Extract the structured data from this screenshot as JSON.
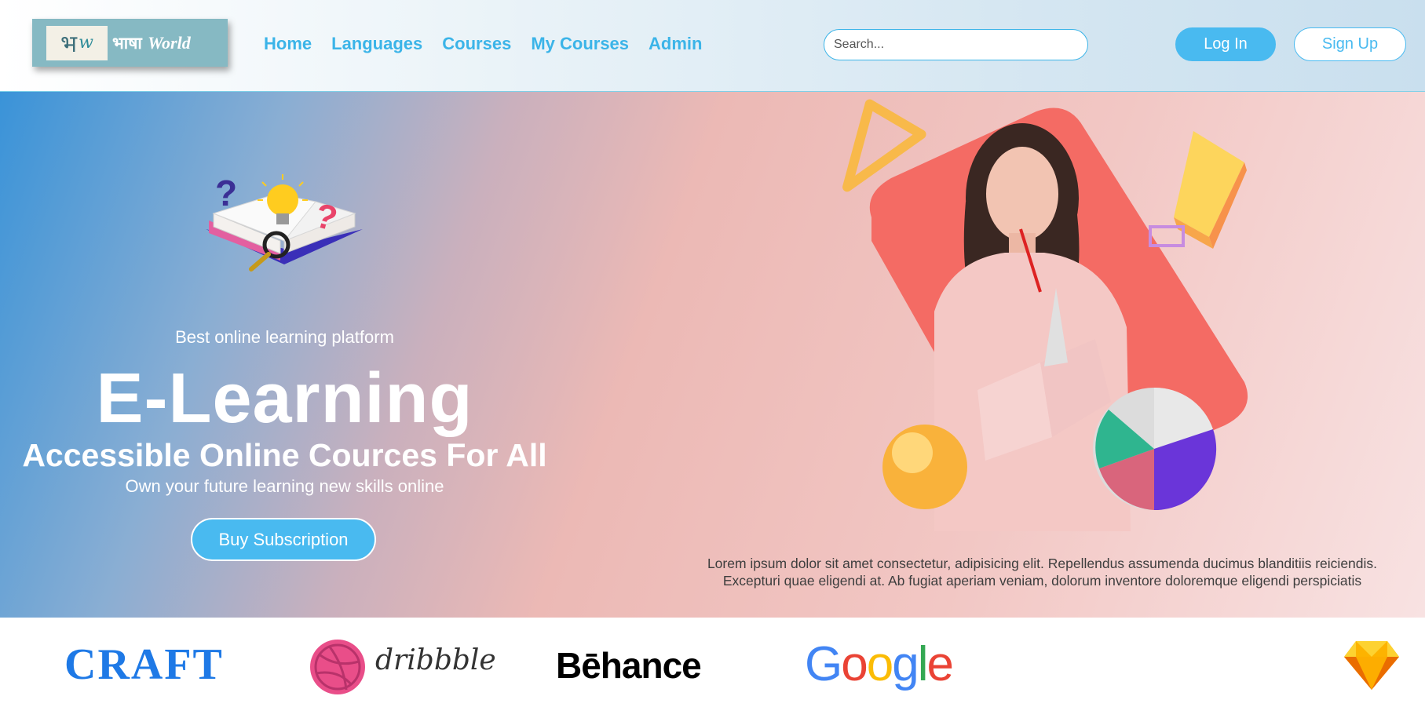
{
  "header": {
    "logo": {
      "mark": "भ",
      "mark_suffix": "w",
      "hindi": "भाषा",
      "english": "World"
    },
    "nav": [
      "Home",
      "Languages",
      "Courses",
      "My Courses",
      "Admin"
    ],
    "search_placeholder": "Search...",
    "login_label": "Log In",
    "signup_label": "Sign Up"
  },
  "hero": {
    "tagline": "Best online learning platform",
    "title": "E-Learning",
    "subtitle": "Accessible Online Cources For All",
    "subtitle2": "Own your future learning new skills online",
    "cta_label": "Buy Subscription",
    "description": "Lorem ipsum dolor sit amet consectetur, adipisicing elit. Repellendus assumenda ducimus blanditiis reiciendis. Excepturi quae eligendi at. Ab fugiat aperiam veniam, dolorum inventore doloremque eligendi perspiciatis"
  },
  "partners": {
    "craft": "CRAFT",
    "dribbble": "dribbble",
    "behance": "Bēhance",
    "google": [
      "G",
      "o",
      "o",
      "g",
      "l",
      "e"
    ],
    "google_colors": [
      "#4285f4",
      "#ea4335",
      "#fbbc05",
      "#4285f4",
      "#34a853",
      "#ea4335"
    ]
  },
  "colors": {
    "accent": "#49baf0",
    "nav": "#3bb4e8",
    "hero_gradient_start": "#3a93d8",
    "hero_gradient_end": "#f8e2e2"
  }
}
